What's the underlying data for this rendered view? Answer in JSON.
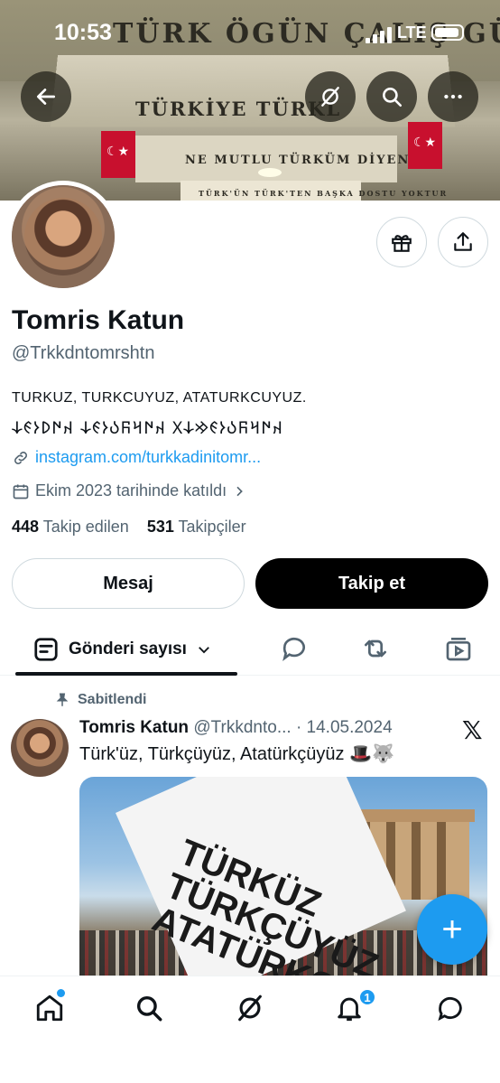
{
  "status_bar": {
    "time": "10:53",
    "network": "LTE"
  },
  "banner": {
    "line1": "TÜRK ÖGÜN ÇALIŞ GÜVEN",
    "line2": "TÜRKİYE TÜRKL",
    "line3": "NE MUTLU TÜRKÜM DİYENE",
    "line4": "TÜRK'ÜN TÜRK'TEN BAŞKA DOSTU YOKTUR"
  },
  "profile": {
    "name": "Tomris Katun",
    "handle": "@Trkkdntomrshtn",
    "bio_line1": "TURKUZ, TURKCUYUZ, ATATURKCUYUZ.",
    "bio_line2": "𐰴𐰇𐰺𐰜𐰉𐰆𐰏𐰢𐰸𐰓 𐰴𐰇𐰺𐰜𐰉𐰆𐰏𐰸 𐰴𐰇𐰖𐰆𐰏𐰸",
    "link": "instagram.com/turkkadinitomr...",
    "joined": "Ekim 2023 tarihinde katıldı",
    "following_count": "448",
    "following_label": "Takip edilen",
    "followers_count": "531",
    "followers_label": "Takipçiler"
  },
  "buttons": {
    "message": "Mesaj",
    "follow": "Takip et"
  },
  "tabs": {
    "posts": "Gönderi sayısı"
  },
  "post": {
    "pinned_label": "Sabitlendi",
    "author": "Tomris Katun",
    "handle_date": "@Trkkdnto... · 14.05.2024",
    "text": "Türk'üz, Türkçüyüz, Atatürkçüyüz 🎩🐺",
    "image_text": "TÜRKÜZ TÜRKÇÜYÜZ ATATÜRKÇ"
  },
  "bottom_nav": {
    "notification_count": "1"
  },
  "colors": {
    "accent": "#1d9bf0",
    "text": "#0f1419",
    "muted": "#536471"
  }
}
